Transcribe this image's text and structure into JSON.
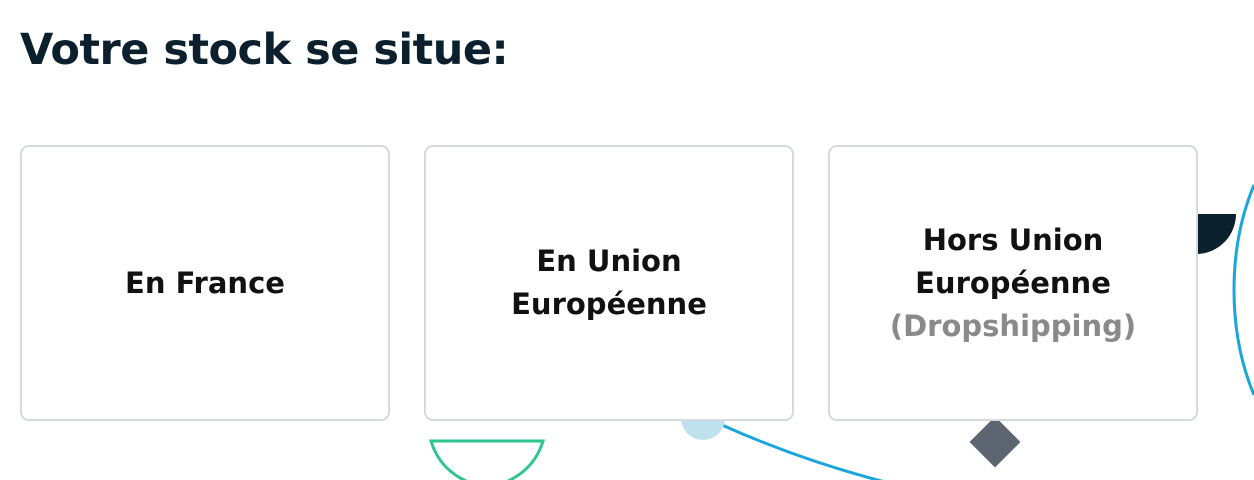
{
  "heading": "Votre stock se situe:",
  "options": [
    {
      "lines": [
        "En France"
      ]
    },
    {
      "lines": [
        "En Union",
        "Européenne"
      ]
    },
    {
      "lines": [
        "Hors Union",
        "Européenne"
      ],
      "note": "(Dropshipping)"
    }
  ],
  "colors": {
    "heading": "#0b1f2c",
    "card_border": "#d5dadf",
    "note": "#8a8a8a",
    "deco_blue": "#1aa6da",
    "deco_light_blue": "#bfe1ee",
    "deco_green": "#2ec58f",
    "deco_gray": "#5d6670",
    "deco_navy": "#0b1f2c"
  }
}
